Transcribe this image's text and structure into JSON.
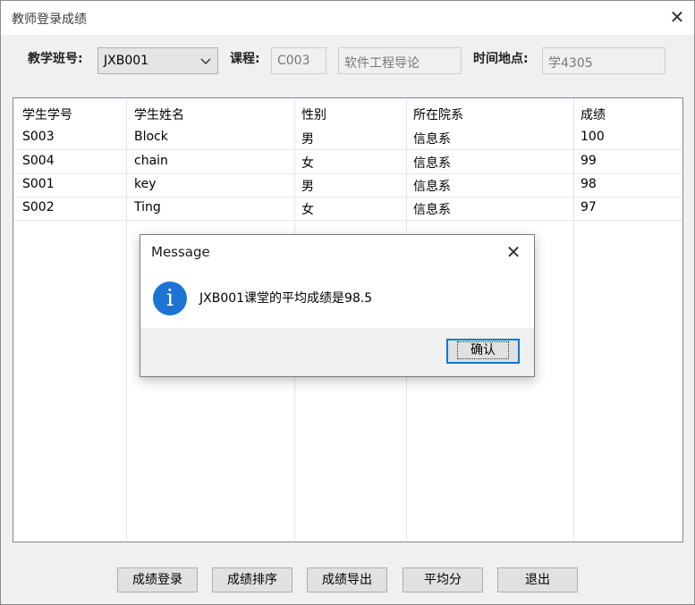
{
  "window": {
    "title": "教师登录成绩"
  },
  "form": {
    "class_label": "教学班号:",
    "class_value": "JXB001",
    "course_label": "课程:",
    "course_code": "C003",
    "course_name": "软件工程导论",
    "location_label": "时间地点:",
    "location_value": "学4305"
  },
  "table": {
    "headers": [
      "学生学号",
      "学生姓名",
      "性别",
      "所在院系",
      "成绩"
    ],
    "rows": [
      [
        "S003",
        "Block",
        "男",
        "信息系",
        "100"
      ],
      [
        "S004",
        "chain",
        "女",
        "信息系",
        "99"
      ],
      [
        "S001",
        "key",
        "男",
        "信息系",
        "98"
      ],
      [
        "S002",
        "Ting",
        "女",
        "信息系",
        "97"
      ]
    ]
  },
  "buttons": {
    "enter": "成绩登录",
    "sort": "成绩排序",
    "export": "成绩导出",
    "average": "平均分",
    "exit": "退出"
  },
  "dialog": {
    "title": "Message",
    "icon": "info-icon",
    "message": "JXB001课堂的平均成绩是98.5",
    "ok": "确认"
  }
}
